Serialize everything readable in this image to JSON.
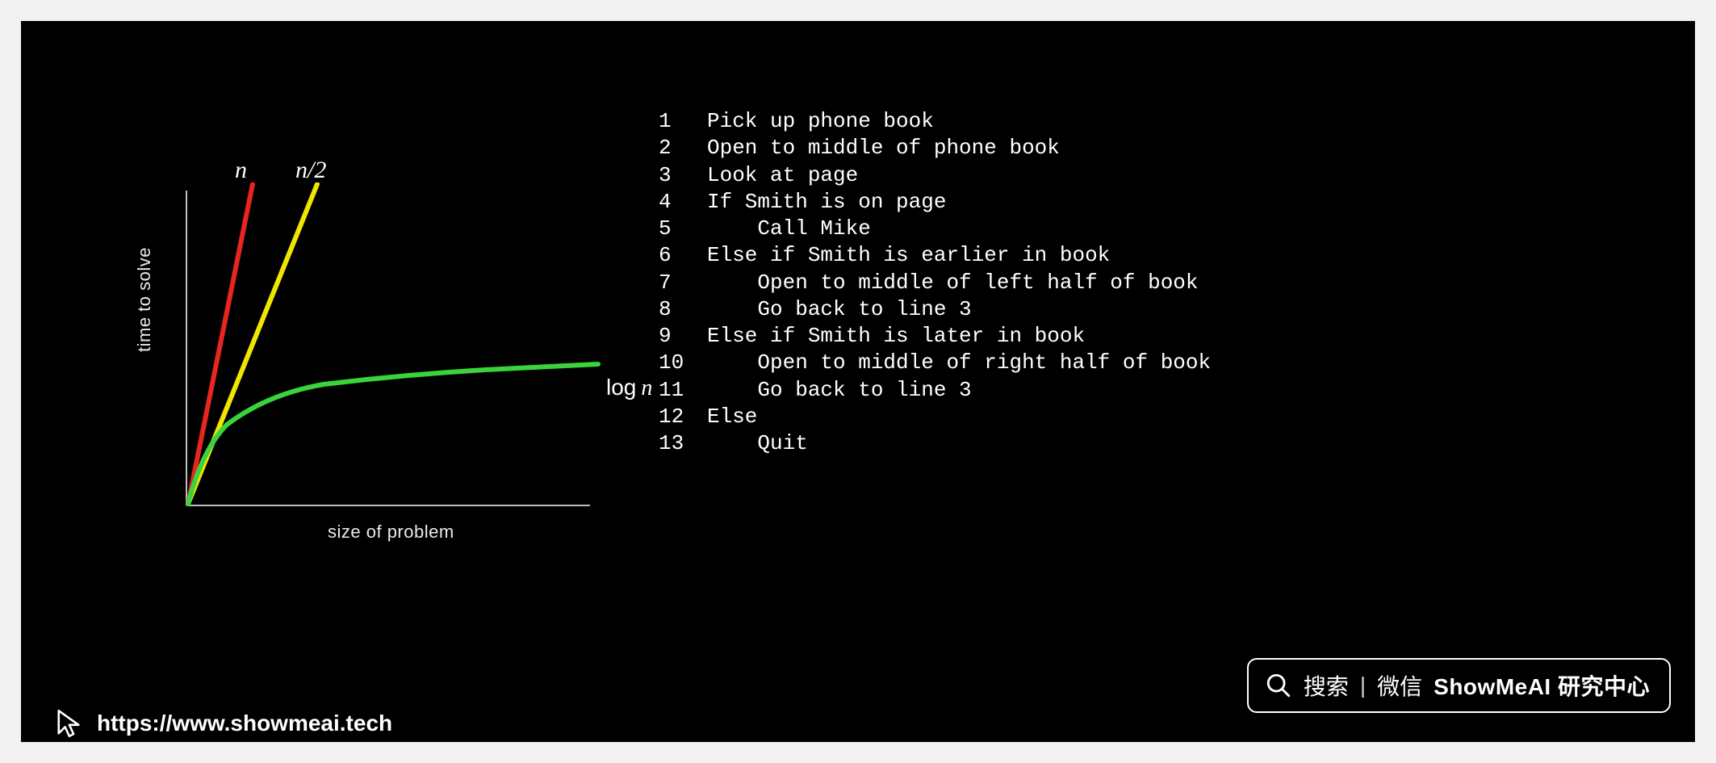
{
  "chart_data": {
    "type": "line",
    "title": "",
    "xlabel": "size of problem",
    "ylabel": "time to solve",
    "xlim": [
      0,
      100
    ],
    "ylim": [
      0,
      100
    ],
    "grid": false,
    "legend_position": "inline",
    "series": [
      {
        "name": "n",
        "label": "n",
        "color": "#e6261f",
        "x": [
          0,
          100
        ],
        "values": [
          0,
          100
        ],
        "note": "linear, drawn as steepest line exiting top near x≈15"
      },
      {
        "name": "n/2",
        "label": "n/2",
        "color": "#f2e500",
        "x": [
          0,
          100
        ],
        "values": [
          0,
          50
        ],
        "note": "linear half-slope, drawn exiting top near x≈30"
      },
      {
        "name": "log n",
        "label": "log n",
        "color": "#3bd33b",
        "x": [
          1,
          2,
          4,
          8,
          16,
          32,
          64,
          100
        ],
        "values": [
          0,
          5,
          10,
          15,
          20,
          25,
          30,
          33
        ],
        "note": "logarithmic curve flattening to the right"
      }
    ]
  },
  "pseudocode": {
    "lines": [
      {
        "n": "1",
        "text": "Pick up phone book"
      },
      {
        "n": "2",
        "text": "Open to middle of phone book"
      },
      {
        "n": "3",
        "text": "Look at page"
      },
      {
        "n": "4",
        "text": "If Smith is on page"
      },
      {
        "n": "5",
        "text": "    Call Mike"
      },
      {
        "n": "6",
        "text": "Else if Smith is earlier in book"
      },
      {
        "n": "7",
        "text": "    Open to middle of left half of book"
      },
      {
        "n": "8",
        "text": "    Go back to line 3"
      },
      {
        "n": "9",
        "text": "Else if Smith is later in book"
      },
      {
        "n": "10",
        "text": "    Open to middle of right half of book"
      },
      {
        "n": "11",
        "text": "    Go back to line 3"
      },
      {
        "n": "12",
        "text": "Else"
      },
      {
        "n": "13",
        "text": "    Quit"
      }
    ]
  },
  "footer": {
    "url": "https://www.showmeai.tech"
  },
  "badge": {
    "search_word": "搜索",
    "separator": "|",
    "channel": "微信",
    "brand": "ShowMeAI 研究中心"
  }
}
